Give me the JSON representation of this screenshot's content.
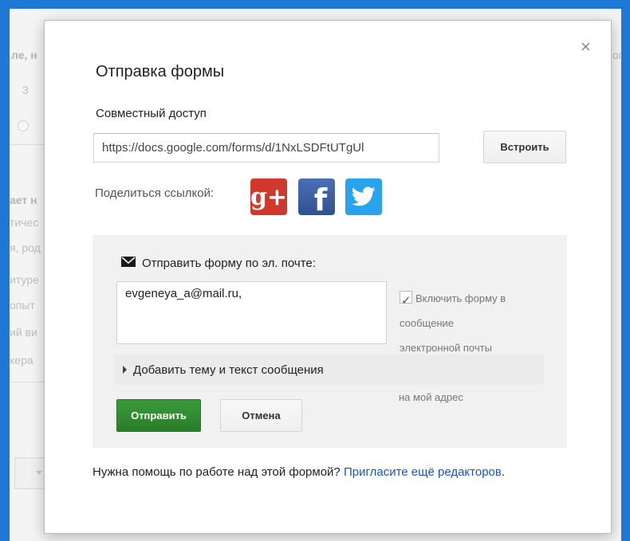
{
  "background": {
    "fragments": [
      "ле, н",
      "3",
      "ает н",
      "тичес",
      "я, род",
      "итуре",
      "опыт",
      "ий ви",
      "кера",
      "ого"
    ]
  },
  "dialog": {
    "title": "Отправка формы",
    "close_label": "×",
    "share_section": {
      "label": "Совместный доступ",
      "url_value": "https://docs.google.com/forms/d/1NxLSDFtUTgUl",
      "embed_button": "Встроить",
      "share_link_label": "Поделиться ссылкой:",
      "social_icons": [
        {
          "name": "google-plus-icon",
          "glyph": "g+"
        },
        {
          "name": "facebook-icon",
          "glyph": "f"
        },
        {
          "name": "twitter-icon",
          "glyph": ""
        }
      ]
    },
    "email_panel": {
      "label": "Отправить форму по эл. почте:",
      "recipients": "evgeneya_a@mail.ru,",
      "include_checkbox": {
        "checked": true,
        "line1": "Включить форму в",
        "line2": "сообщение",
        "line3": "электронной почты"
      },
      "add_subject": "Добавить тему и текст сообщения",
      "my_address": "на мой адрес",
      "send_button": "Отправить",
      "cancel_button": "Отмена"
    },
    "help": {
      "text": "Нужна помощь по работе над этой формой?",
      "link": "Пригласите ещё редакторов",
      "suffix": "."
    }
  },
  "colors": {
    "frame": "#1e78d6",
    "send_button": "#2f8a2f",
    "link": "#1a55c0",
    "google_plus": "#d0382b",
    "facebook": "#3b5998",
    "twitter": "#2aa3ef"
  }
}
